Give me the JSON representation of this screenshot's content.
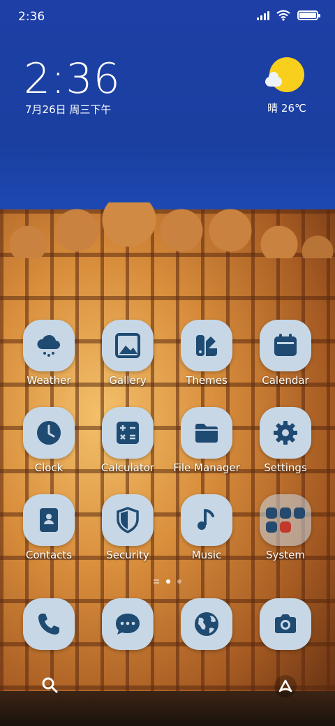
{
  "status_bar": {
    "time": "2:36",
    "icons": [
      "signal-icon",
      "wifi-icon",
      "battery-icon"
    ],
    "battery_level": 1.0
  },
  "clock_widget": {
    "time": "2:36",
    "date": "7月26日 周三下午"
  },
  "weather_widget": {
    "icon": "sun-partly-cloudy-icon",
    "text": "晴 26℃"
  },
  "apps": [
    {
      "label": "Weather",
      "icon": "cloud-rain-icon"
    },
    {
      "label": "Gallery",
      "icon": "image-icon"
    },
    {
      "label": "Themes",
      "icon": "paint-palette-icon"
    },
    {
      "label": "Calendar",
      "icon": "calendar-icon"
    },
    {
      "label": "Clock",
      "icon": "clock-icon"
    },
    {
      "label": "Calculator",
      "icon": "calculator-icon"
    },
    {
      "label": "File Manager",
      "icon": "folder-icon"
    },
    {
      "label": "Settings",
      "icon": "gear-icon"
    },
    {
      "label": "Contacts",
      "icon": "contacts-book-icon"
    },
    {
      "label": "Security",
      "icon": "shield-icon"
    },
    {
      "label": "Music",
      "icon": "music-note-icon"
    },
    {
      "label": "System",
      "icon": "folder-grid-icon"
    }
  ],
  "page_indicator": {
    "pages": 2,
    "current": 1
  },
  "dock": [
    {
      "icon": "phone-icon"
    },
    {
      "icon": "message-bubble-icon"
    },
    {
      "icon": "globe-browser-icon"
    },
    {
      "icon": "camera-icon"
    }
  ],
  "colors": {
    "icon_bg": "#c7d7e6",
    "icon_fg": "#1f4b72",
    "sun": "#f8cf1c"
  }
}
